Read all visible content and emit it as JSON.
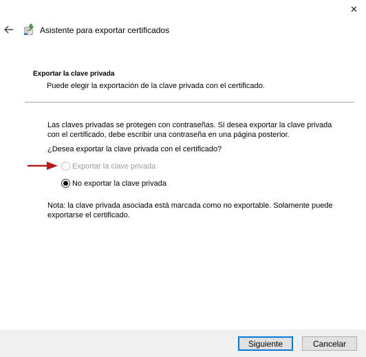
{
  "window": {
    "close_glyph": "✕",
    "title": "Asistente para exportar certificados"
  },
  "header": {
    "section_title": "Exportar la clave privada",
    "section_subtitle": "Puede elegir la exportación de la clave privada con el certificado."
  },
  "body": {
    "description": "Las claves privadas se protegen con contraseñas. Si desea exportar la clave privada con el certificado, debe escribir una contraseña en una página posterior.",
    "question": "¿Desea exportar la clave privada con el certificado?",
    "options": [
      {
        "label": "Exportar la clave privada",
        "checked": false,
        "disabled": true
      },
      {
        "label": "No exportar la clave privada",
        "checked": true,
        "disabled": false
      }
    ],
    "note": "Nota: la clave privada asociada está marcada como no exportable. Solamente puede exportarse el certificado."
  },
  "footer": {
    "next_label": "Siguiente",
    "cancel_label": "Cancelar"
  },
  "colors": {
    "arrow": "#b71c1c",
    "focus_border": "#0078d7",
    "footer_bg": "#f0f0f0"
  },
  "icons": {
    "back": "arrow-left-icon",
    "wizard": "certificate-wizard-icon",
    "annotation": "red-arrow-icon"
  }
}
